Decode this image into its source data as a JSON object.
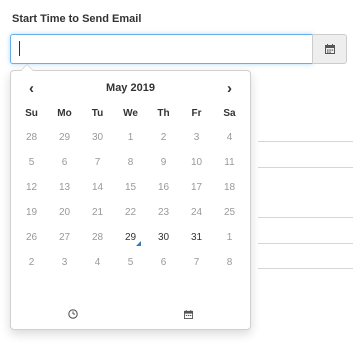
{
  "field": {
    "label": "Start Time to Send Email",
    "value": ""
  },
  "icons": {
    "calendar": "calendar-icon",
    "prev": "chevron-left-icon",
    "next": "chevron-right-icon",
    "clock": "clock-icon"
  },
  "calendar": {
    "month_title": "May 2019",
    "prev_label": "‹",
    "next_label": "›",
    "weekdays": [
      "Su",
      "Mo",
      "Tu",
      "We",
      "Th",
      "Fr",
      "Sa"
    ],
    "weeks": [
      [
        "28",
        "29",
        "30",
        "1",
        "2",
        "3",
        "4"
      ],
      [
        "5",
        "6",
        "7",
        "8",
        "9",
        "10",
        "11"
      ],
      [
        "12",
        "13",
        "14",
        "15",
        "16",
        "17",
        "18"
      ],
      [
        "19",
        "20",
        "21",
        "22",
        "23",
        "24",
        "25"
      ],
      [
        "26",
        "27",
        "28",
        "29",
        "30",
        "31",
        "1"
      ],
      [
        "2",
        "3",
        "4",
        "5",
        "6",
        "7",
        "8"
      ]
    ],
    "today": "29"
  },
  "colors": {
    "accent": "#337ab7",
    "focus_border": "#66afe9",
    "muted_text": "#999999"
  }
}
